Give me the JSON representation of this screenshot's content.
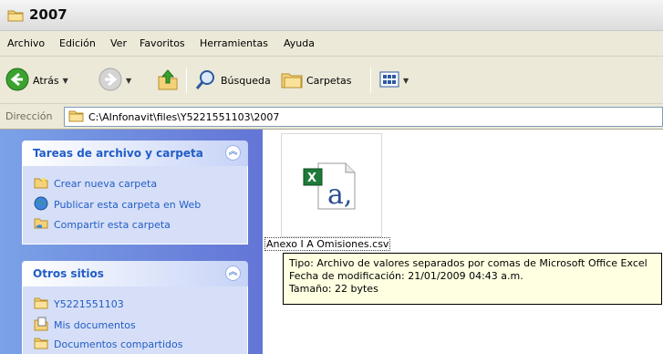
{
  "window": {
    "title": "2007"
  },
  "menubar": {
    "items": [
      "Archivo",
      "Edición",
      "Ver",
      "Favoritos",
      "Herramientas",
      "Ayuda"
    ]
  },
  "toolbar": {
    "back_label": "Atrás",
    "search_label": "Búsqueda",
    "folders_label": "Carpetas"
  },
  "address": {
    "label": "Dirección",
    "path": "C:\\AInfonavit\\files\\Y5221551103\\2007"
  },
  "tasks_panel": {
    "title": "Tareas de archivo y carpeta",
    "items": [
      "Crear nueva carpeta",
      "Publicar esta carpeta en Web",
      "Compartir esta carpeta"
    ]
  },
  "other_places": {
    "title": "Otros sitios",
    "items": [
      "Y5221551103",
      "Mis documentos",
      "Documentos compartidos"
    ]
  },
  "file": {
    "name": "Anexo I A Omisiones.csv"
  },
  "tooltip": {
    "type": "Tipo: Archivo de valores separados por comas de Microsoft Office Excel",
    "modified": "Fecha de modificación: 21/01/2009 04:43 a.m.",
    "size": "Tamaño: 22 bytes"
  },
  "colors": {
    "taskpane_blue": "#6375d6",
    "link_blue": "#215dc6",
    "tooltip_bg": "#ffffe1",
    "chrome": "#ece9d8"
  }
}
